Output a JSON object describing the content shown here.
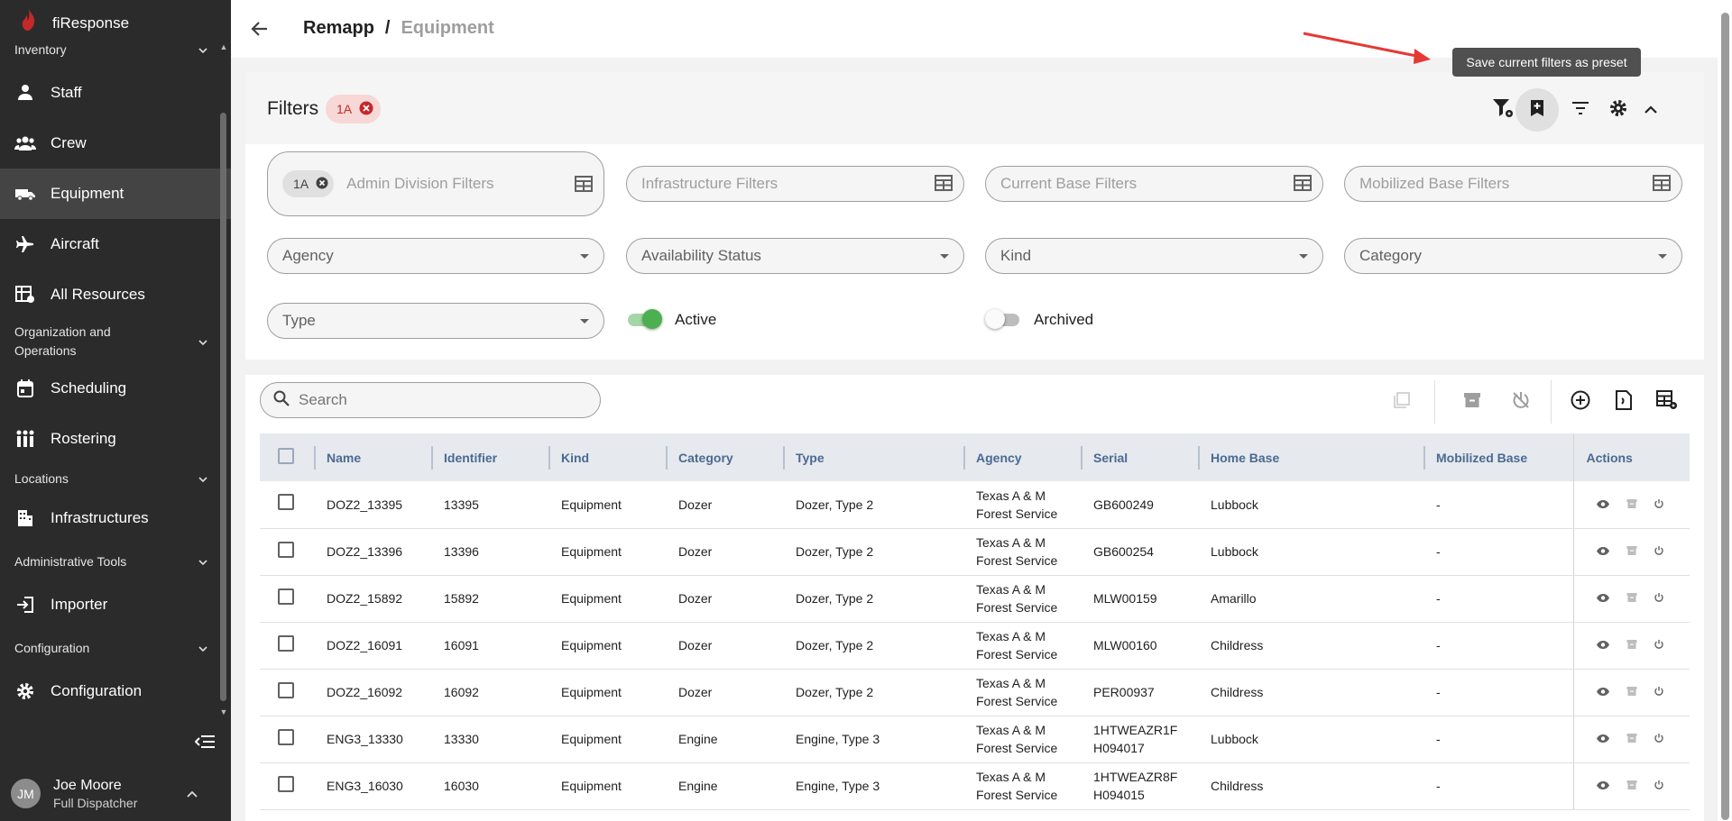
{
  "app": {
    "name": "fiResponse"
  },
  "sidebar": {
    "sections": {
      "inventory": "Inventory",
      "org_ops": "Organization and Operations",
      "locations": "Locations",
      "admin_tools": "Administrative Tools",
      "configuration": "Configuration"
    },
    "items": {
      "staff": "Staff",
      "crew": "Crew",
      "equipment": "Equipment",
      "aircraft": "Aircraft",
      "all_resources": "All Resources",
      "scheduling": "Scheduling",
      "rostering": "Rostering",
      "infrastructures": "Infrastructures",
      "importer": "Importer",
      "configuration": "Configuration"
    },
    "user": {
      "initials": "JM",
      "name": "Joe Moore",
      "role": "Full Dispatcher"
    }
  },
  "header": {
    "root": "Remapp",
    "separator": "/",
    "current": "Equipment"
  },
  "tooltip": "Save current filters as preset",
  "filters": {
    "title": "Filters",
    "active_chip": "1A",
    "admin_chip": "1A",
    "admin_placeholder": "Admin Division Filters",
    "infra_placeholder": "Infrastructure Filters",
    "current_base_placeholder": "Current Base Filters",
    "mobilized_base_placeholder": "Mobilized Base Filters",
    "agency": "Agency",
    "availability": "Availability Status",
    "kind": "Kind",
    "category": "Category",
    "type": "Type",
    "active_label": "Active",
    "active_on": true,
    "archived_label": "Archived",
    "archived_on": false
  },
  "table": {
    "search_placeholder": "Search",
    "columns": [
      "Name",
      "Identifier",
      "Kind",
      "Category",
      "Type",
      "Agency",
      "Serial",
      "Home Base",
      "Mobilized Base",
      "Actions"
    ],
    "rows": [
      {
        "name": "DOZ2_13395",
        "identifier": "13395",
        "kind": "Equipment",
        "category": "Dozer",
        "type": "Dozer, Type 2",
        "agency1": "Texas A & M",
        "agency2": "Forest Service",
        "serial1": "GB600249",
        "serial2": "",
        "home_base": "Lubbock",
        "mobilized": "-"
      },
      {
        "name": "DOZ2_13396",
        "identifier": "13396",
        "kind": "Equipment",
        "category": "Dozer",
        "type": "Dozer, Type 2",
        "agency1": "Texas A & M",
        "agency2": "Forest Service",
        "serial1": "GB600254",
        "serial2": "",
        "home_base": "Lubbock",
        "mobilized": "-"
      },
      {
        "name": "DOZ2_15892",
        "identifier": "15892",
        "kind": "Equipment",
        "category": "Dozer",
        "type": "Dozer, Type 2",
        "agency1": "Texas A & M",
        "agency2": "Forest Service",
        "serial1": "MLW00159",
        "serial2": "",
        "home_base": "Amarillo",
        "mobilized": "-"
      },
      {
        "name": "DOZ2_16091",
        "identifier": "16091",
        "kind": "Equipment",
        "category": "Dozer",
        "type": "Dozer, Type 2",
        "agency1": "Texas A & M",
        "agency2": "Forest Service",
        "serial1": "MLW00160",
        "serial2": "",
        "home_base": "Childress",
        "mobilized": "-"
      },
      {
        "name": "DOZ2_16092",
        "identifier": "16092",
        "kind": "Equipment",
        "category": "Dozer",
        "type": "Dozer, Type 2",
        "agency1": "Texas A & M",
        "agency2": "Forest Service",
        "serial1": "PER00937",
        "serial2": "",
        "home_base": "Childress",
        "mobilized": "-"
      },
      {
        "name": "ENG3_13330",
        "identifier": "13330",
        "kind": "Equipment",
        "category": "Engine",
        "type": "Engine, Type 3",
        "agency1": "Texas A & M",
        "agency2": "Forest Service",
        "serial1": "1HTWEAZR1F",
        "serial2": "H094017",
        "home_base": "Lubbock",
        "mobilized": "-"
      },
      {
        "name": "ENG3_16030",
        "identifier": "16030",
        "kind": "Equipment",
        "category": "Engine",
        "type": "Engine, Type 3",
        "agency1": "Texas A & M",
        "agency2": "Forest Service",
        "serial1": "1HTWEAZR8F",
        "serial2": "H094015",
        "home_base": "Childress",
        "mobilized": "-"
      }
    ]
  },
  "colors": {
    "accent": "#4caf50",
    "sidebar": "#2b2b2b",
    "chip_text": "#c62828",
    "chip_bg": "#f8d7d7",
    "annotation_arrow": "#e53935"
  }
}
